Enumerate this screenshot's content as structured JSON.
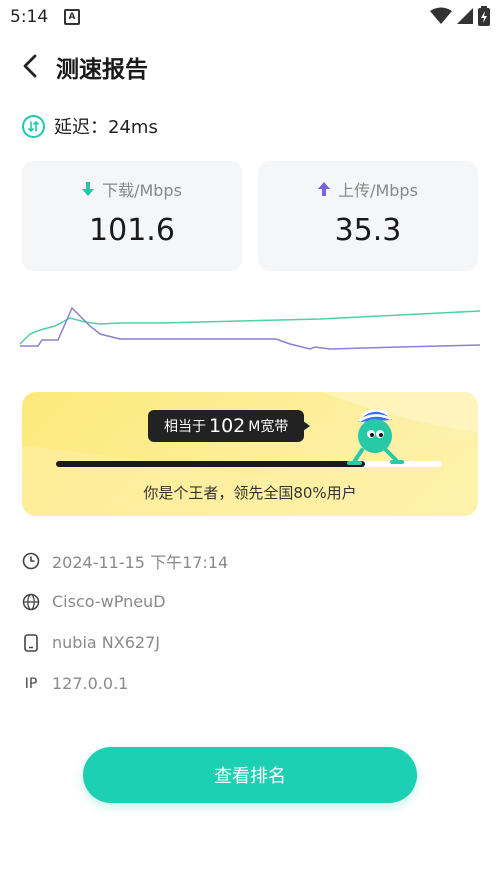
{
  "status_bar": {
    "time": "5:14",
    "notification_badge": "A"
  },
  "header": {
    "title": "测速报告"
  },
  "latency": {
    "text": "延迟：24ms"
  },
  "download": {
    "label": "下载/Mbps",
    "value": "101.6",
    "arrow_color": "#1fc8b0"
  },
  "upload": {
    "label": "上传/Mbps",
    "value": "35.3",
    "arrow_color": "#7a62d8"
  },
  "graph": {
    "download_color": "#4fd1a6",
    "upload_color": "#8b7fd6"
  },
  "rank": {
    "prefix": "相当于",
    "bandwidth": "102",
    "suffix": "M宽带",
    "progress": 0.8,
    "text": "你是个王者，领先全国80%用户"
  },
  "info": {
    "time": "2024-11-15 下午17:14",
    "network": "Cisco-wPneuD",
    "device": "nubia NX627J",
    "ip_label": "IP",
    "ip": "127.0.0.1"
  },
  "button": {
    "label": "查看排名"
  },
  "colors": {
    "accent": "#1ed0b3",
    "banner": "#fde97a"
  }
}
